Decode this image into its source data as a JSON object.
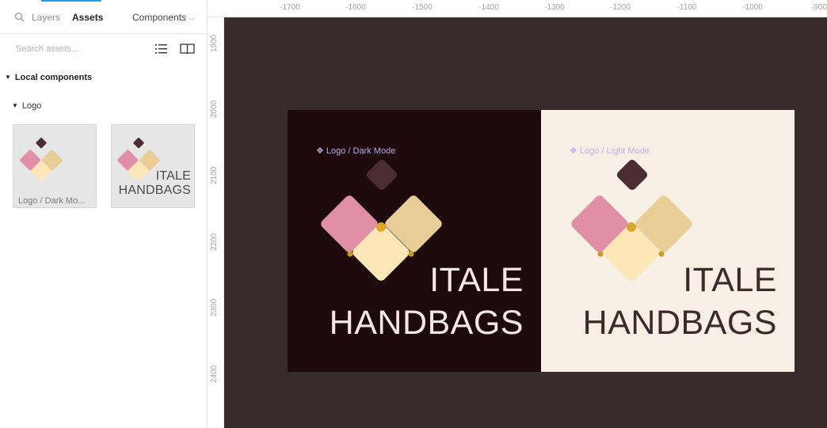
{
  "panel": {
    "tabs": {
      "layers": "Layers",
      "assets": "Assets"
    },
    "components_dropdown": "Components",
    "search": {
      "placeholder": "Search assets...",
      "value": ""
    },
    "sections": {
      "local_components": "Local components",
      "logo_group": "Logo"
    },
    "thumbnails": [
      {
        "label": "Logo / Dark Mo..."
      },
      {
        "text_line1": "ITALE",
        "text_line2": "HANDBAGS"
      }
    ]
  },
  "ruler": {
    "x_ticks": [
      "-1700",
      "-1600",
      "-1500",
      "-1400",
      "-1300",
      "-1200",
      "-1100",
      "-1000",
      "-900"
    ],
    "y_ticks": [
      "1900",
      "2000",
      "2100",
      "2200",
      "2300",
      "2400"
    ]
  },
  "canvas": {
    "dark_frame": {
      "label": "Logo / Dark Mode",
      "text_line1": "ITALE",
      "text_line2": "HANDBAGS"
    },
    "light_frame": {
      "label": "Logo / Light Mode",
      "text_line1": "ITALE",
      "text_line2": "HANDBAGS"
    }
  },
  "colors": {
    "accent": "#18a0fb",
    "canvas_bg": "#372b2b",
    "dark_frame_bg": "#1c0a0d",
    "light_frame_bg": "#f7efe3",
    "pink": "#e08fa6",
    "tan": "#e8cd97",
    "cream": "#fde6b8",
    "plum": "#4a2d33",
    "gold": "#d9a82a",
    "component_label": "#b9a6e6"
  }
}
